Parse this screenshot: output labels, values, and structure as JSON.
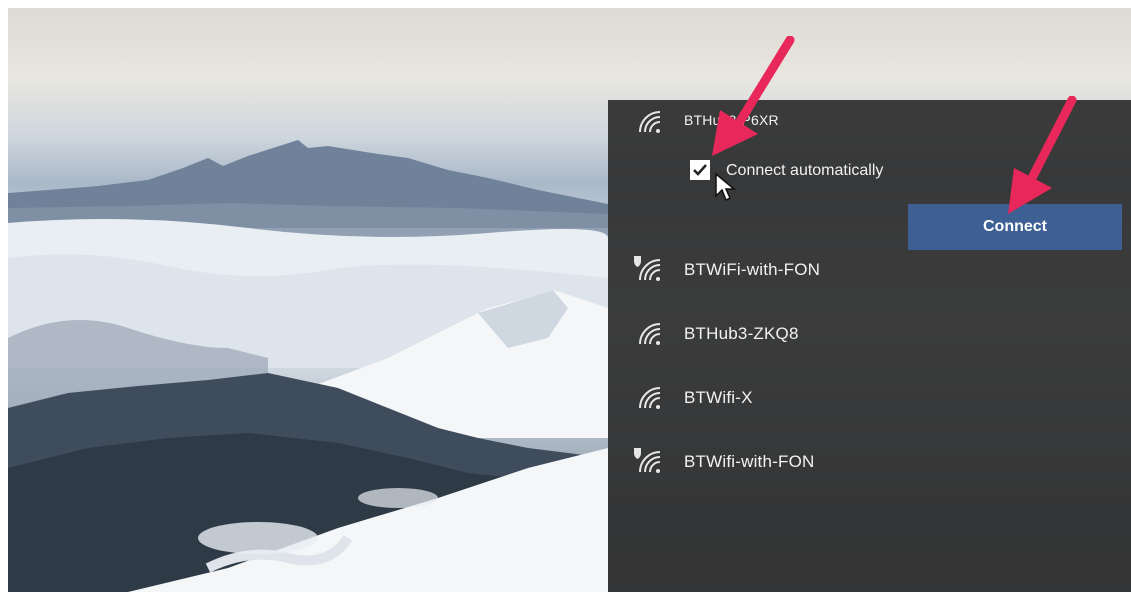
{
  "wifi_panel": {
    "selected_network": {
      "name": "BTHub3-P6XR",
      "auto_connect_label": "Connect automatically",
      "auto_connect_checked": true,
      "connect_label": "Connect"
    },
    "networks": [
      {
        "name": "BTWiFi-with-FON",
        "icon": "wifi-shield-icon"
      },
      {
        "name": "BTHub3-ZKQ8",
        "icon": "wifi-icon"
      },
      {
        "name": "BTWifi-X",
        "icon": "wifi-icon"
      },
      {
        "name": "BTWifi-with-FON",
        "icon": "wifi-shield-icon"
      }
    ]
  },
  "colors": {
    "panel_bg": "#303030",
    "connect_button": "#3d5f94",
    "annotation_arrow": "#e8275a"
  }
}
